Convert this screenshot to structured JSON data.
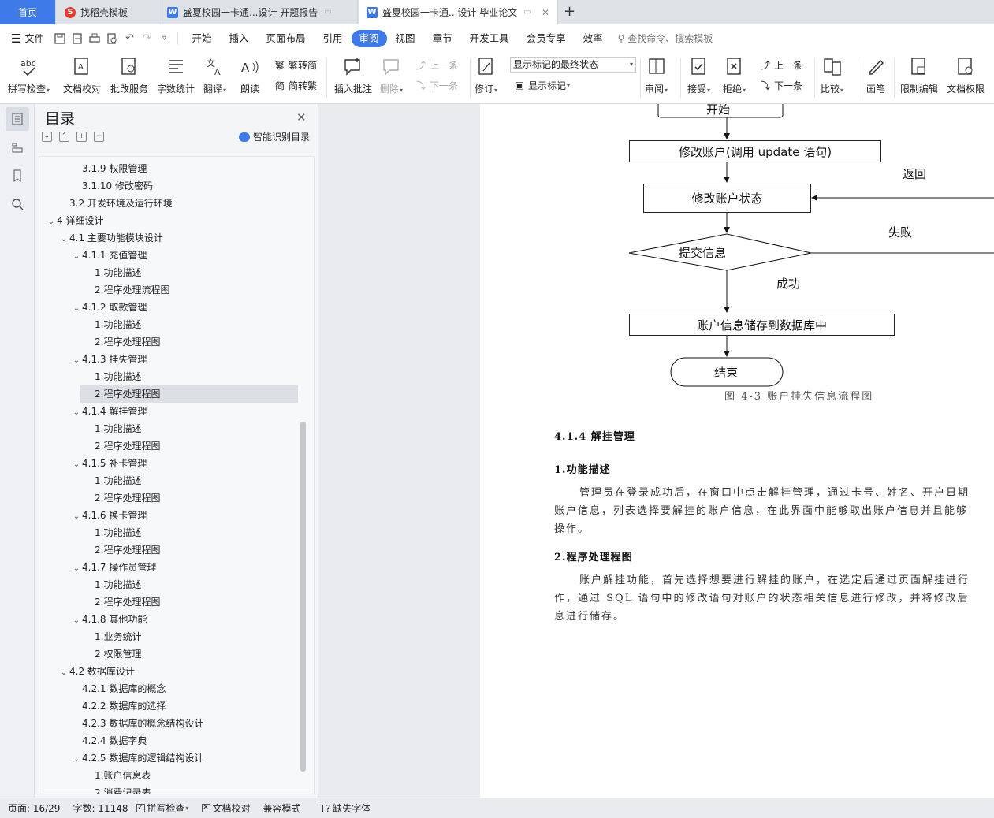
{
  "tabs": {
    "home": "首页",
    "t1": "找稻壳模板",
    "t2": "盛夏校园一卡通...设计 开题报告",
    "t3": "盛夏校园一卡通...设计 毕业论文",
    "add": "+"
  },
  "menu": {
    "file": "文件",
    "items": [
      "开始",
      "插入",
      "页面布局",
      "引用",
      "审阅",
      "视图",
      "章节",
      "开发工具",
      "会员专享",
      "效率"
    ],
    "active": "审阅",
    "search": "查找命令、搜索模板"
  },
  "ribbon": {
    "spellcheck": "拼写检查",
    "doccheck": "文档校对",
    "batch": "批改服务",
    "wordcount": "字数统计",
    "translate": "翻译",
    "read": "朗读",
    "trad": "繁转简",
    "simp": "简转繁",
    "insert_comment": "插入批注",
    "delete": "删除",
    "prev": "上一条",
    "next": "下一条",
    "revise": "修订",
    "display_state": "显示标记的最终状态",
    "show_marks": "显示标记",
    "review": "审阅",
    "accept": "接受",
    "reject": "拒绝",
    "prev2": "上一条",
    "next2": "下一条",
    "compare": "比较",
    "pen": "画笔",
    "restrict": "限制编辑",
    "permission": "文档权限"
  },
  "toc": {
    "title": "目录",
    "smart": "智能识别目录",
    "items": [
      {
        "label": "3.1.9  权限管理",
        "level": 3,
        "chev": ""
      },
      {
        "label": "3.1.10  修改密码",
        "level": 3,
        "chev": ""
      },
      {
        "label": "3.2  开发环境及运行环境",
        "level": 2,
        "chev": ""
      },
      {
        "label": "4  详细设计",
        "level": 1,
        "chev": "v"
      },
      {
        "label": "4.1  主要功能模块设计",
        "level": 2,
        "chev": "v"
      },
      {
        "label": "4.1.1  充值管理",
        "level": 3,
        "chev": "v"
      },
      {
        "label": "1.功能描述",
        "level": 4,
        "chev": ""
      },
      {
        "label": "2.程序处理流程图",
        "level": 4,
        "chev": ""
      },
      {
        "label": "4.1.2  取款管理",
        "level": 3,
        "chev": "v"
      },
      {
        "label": "1.功能描述",
        "level": 4,
        "chev": ""
      },
      {
        "label": "2.程序处理程图",
        "level": 4,
        "chev": ""
      },
      {
        "label": "4.1.3  挂失管理",
        "level": 3,
        "chev": "v"
      },
      {
        "label": "1.功能描述",
        "level": 4,
        "chev": ""
      },
      {
        "label": "2.程序处理程图",
        "level": 4,
        "chev": "",
        "selected": true
      },
      {
        "label": "4.1.4  解挂管理",
        "level": 3,
        "chev": "v"
      },
      {
        "label": "1.功能描述",
        "level": 4,
        "chev": ""
      },
      {
        "label": "2.程序处理程图",
        "level": 4,
        "chev": ""
      },
      {
        "label": "4.1.5  补卡管理",
        "level": 3,
        "chev": "v"
      },
      {
        "label": "1.功能描述",
        "level": 4,
        "chev": ""
      },
      {
        "label": "2.程序处理程图",
        "level": 4,
        "chev": ""
      },
      {
        "label": "4.1.6  换卡管理",
        "level": 3,
        "chev": "v"
      },
      {
        "label": "1.功能描述",
        "level": 4,
        "chev": ""
      },
      {
        "label": "2.程序处理程图",
        "level": 4,
        "chev": ""
      },
      {
        "label": "4.1.7  操作员管理",
        "level": 3,
        "chev": "v"
      },
      {
        "label": "1.功能描述",
        "level": 4,
        "chev": ""
      },
      {
        "label": "2.程序处理程图",
        "level": 4,
        "chev": ""
      },
      {
        "label": "4.1.8  其他功能",
        "level": 3,
        "chev": "v"
      },
      {
        "label": "1.业务统计",
        "level": 4,
        "chev": ""
      },
      {
        "label": "2.权限管理",
        "level": 4,
        "chev": ""
      },
      {
        "label": "4.2  数据库设计",
        "level": 2,
        "chev": "v"
      },
      {
        "label": "4.2.1  数据库的概念",
        "level": 3,
        "chev": ""
      },
      {
        "label": "4.2.2  数据库的选择",
        "level": 3,
        "chev": ""
      },
      {
        "label": "4.2.3  数据库的概念结构设计",
        "level": 3,
        "chev": ""
      },
      {
        "label": "4.2.4  数据字典",
        "level": 3,
        "chev": ""
      },
      {
        "label": "4.2.5  数据库的逻辑结构设计",
        "level": 3,
        "chev": "v"
      },
      {
        "label": "1.账户信息表",
        "level": 4,
        "chev": ""
      },
      {
        "label": "2.消费记录表",
        "level": 4,
        "chev": ""
      }
    ]
  },
  "flowchart": {
    "start": "开始",
    "modify_account": "修改账户(调用 update 语句)",
    "modify_status": "修改账户状态",
    "submit": "提交信息",
    "store": "账户信息储存到数据库中",
    "end": "结束",
    "return_label": "返回",
    "fail_label": "失败",
    "success_label": "成功",
    "caption": "图 4-3  账户挂失信息流程图"
  },
  "doc": {
    "h_section": "4.1.4  解挂管理",
    "h_func": "1.功能描述",
    "p_func": [
      "管理员在登录成功后，在窗口中点击解挂管理，通过卡号、姓名、开户日期",
      "账户信息，列表选择要解挂的账户信息，在此界面中能够取出账户信息并且能够",
      "操作。"
    ],
    "h_proc": "2.程序处理程图",
    "p_proc": [
      "账户解挂功能，首先选择想要进行解挂的账户，在选定后通过页面解挂进行",
      "作，通过 SQL 语句中的修改语句对账户的状态相关信息进行修改，并将修改后",
      "息进行储存。"
    ]
  },
  "status": {
    "page": "页面: 16/29",
    "words": "字数: 11148",
    "spell": "拼写检查",
    "proof": "文档校对",
    "compat": "兼容模式",
    "missing_font": "缺失字体"
  }
}
